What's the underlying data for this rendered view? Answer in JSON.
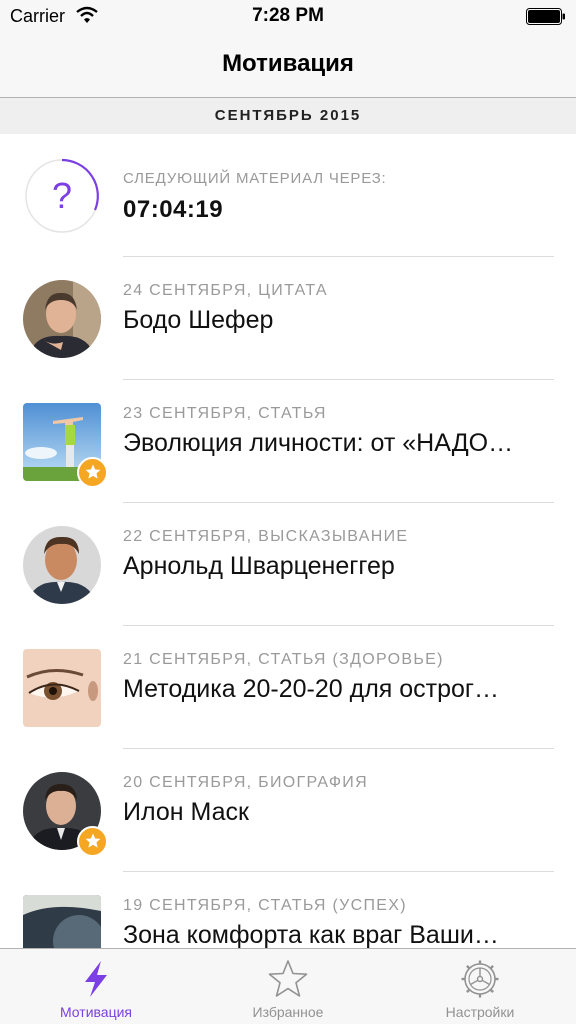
{
  "status_bar": {
    "carrier": "Carrier",
    "time": "7:28 PM"
  },
  "nav": {
    "title": "Мотивация"
  },
  "section": {
    "title": "СЕНТЯБРЬ 2015"
  },
  "timer": {
    "label": "СЛЕДУЮЩИЙ МАТЕРИАЛ ЧЕРЕЗ:",
    "value": "07:04:19",
    "icon": "question-mark-icon"
  },
  "items": [
    {
      "meta": "24 СЕНТЯБРЯ, ЦИТАТА",
      "title": "Бодо Шефер",
      "shape": "circle",
      "favorite": false
    },
    {
      "meta": "23 СЕНТЯБРЯ, СТАТЬЯ",
      "title": "Эволюция личности: от «НАДО…",
      "shape": "square",
      "favorite": true
    },
    {
      "meta": "22 СЕНТЯБРЯ, ВЫСКАЗЫВАНИЕ",
      "title": "Арнольд Шварценеггер",
      "shape": "circle",
      "favorite": false
    },
    {
      "meta": "21 СЕНТЯБРЯ, СТАТЬЯ (ЗДОРОВЬЕ)",
      "title": "Методика 20-20-20 для острог…",
      "shape": "square",
      "favorite": false
    },
    {
      "meta": "20 СЕНТЯБРЯ, БИОГРАФИЯ",
      "title": "Илон Маск",
      "shape": "circle",
      "favorite": true
    },
    {
      "meta": "19 СЕНТЯБРЯ, СТАТЬЯ (УСПЕХ)",
      "title": "Зона комфорта как враг Ваши…",
      "shape": "square",
      "favorite": false
    }
  ],
  "tabs": [
    {
      "label": "Мотивация",
      "icon": "lightning-icon",
      "active": true
    },
    {
      "label": "Избранное",
      "icon": "star-icon",
      "active": false
    },
    {
      "label": "Настройки",
      "icon": "gear-icon",
      "active": false
    }
  ],
  "colors": {
    "accent": "#7b3fe4",
    "favorite_badge": "#f5a623",
    "meta_text": "#9a9a9a",
    "bar_bg": "#f7f7f7"
  }
}
